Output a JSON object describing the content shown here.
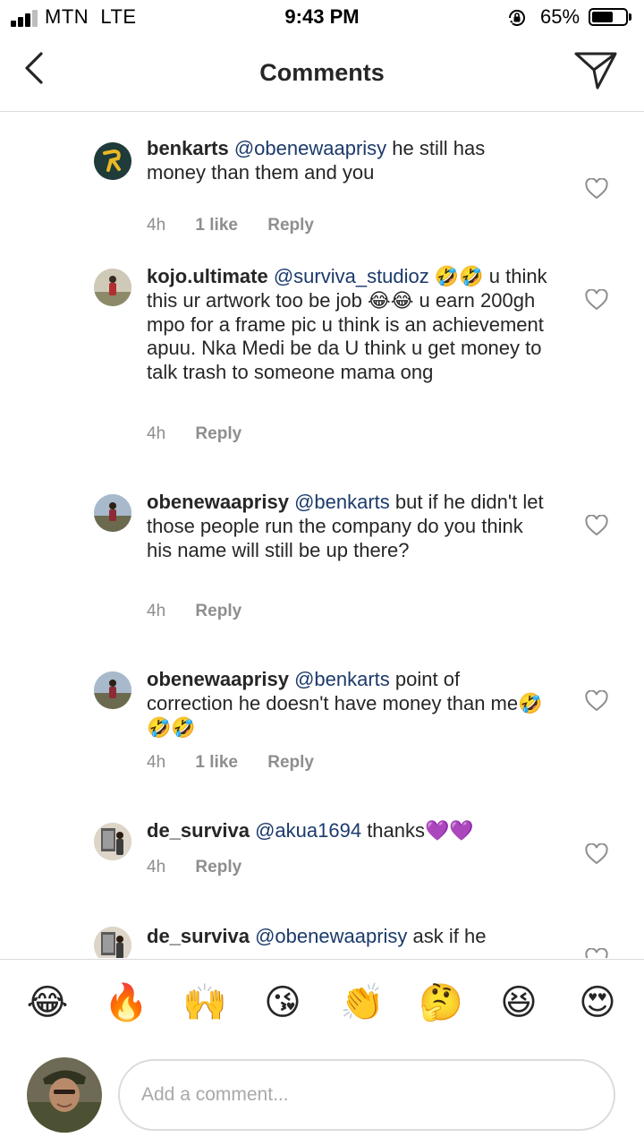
{
  "status_bar": {
    "carrier": "MTN",
    "network": "LTE",
    "time": "9:43 PM",
    "battery_percent": "65%",
    "battery_level": 0.65,
    "signal_bars": 3
  },
  "header": {
    "title": "Comments",
    "back_icon": "chevron-left-icon",
    "share_icon": "paper-plane-icon"
  },
  "comments": [
    {
      "username": "benkarts",
      "mention": "@obenewaaprisy",
      "text": " he still has money than them and you",
      "time": "4h",
      "likes": "1 like",
      "reply": "Reply"
    },
    {
      "username": "kojo.ultimate",
      "mention": "@surviva_studioz",
      "text": " 🤣🤣 u think this ur artwork too be job 😂😂 u earn 200gh  mpo for a frame  pic u think is an achievement apuu.  Nka Medi be da U think  u get money to talk trash to someone mama ong",
      "time": "4h",
      "likes": "",
      "reply": "Reply"
    },
    {
      "username": "obenewaaprisy",
      "mention": "@benkarts",
      "text": " but if he didn't let those people run the company do you think his name will still be up there?",
      "time": "4h",
      "likes": "",
      "reply": "Reply"
    },
    {
      "username": "obenewaaprisy",
      "mention": "@benkarts",
      "text": " point of correction he doesn't have money than me🤣🤣🤣",
      "time": "4h",
      "likes": "1 like",
      "reply": "Reply"
    },
    {
      "username": "de_surviva",
      "mention": "@akua1694",
      "text": " thanks💜💜",
      "time": "4h",
      "likes": "",
      "reply": "Reply"
    },
    {
      "username": "de_surviva",
      "mention": "@obenewaaprisy",
      "text": " ask if he",
      "time": "",
      "likes": "",
      "reply": ""
    }
  ],
  "emoji_bar": [
    "😂",
    "🔥",
    "🙌",
    "😘",
    "👏",
    "🤔",
    "😆",
    "😍"
  ],
  "composer": {
    "placeholder": "Add a comment..."
  },
  "colors": {
    "text": "#262626",
    "secondary": "#8e8e8e",
    "mention": "#1b3a6b",
    "divider": "#dbdbdb"
  }
}
